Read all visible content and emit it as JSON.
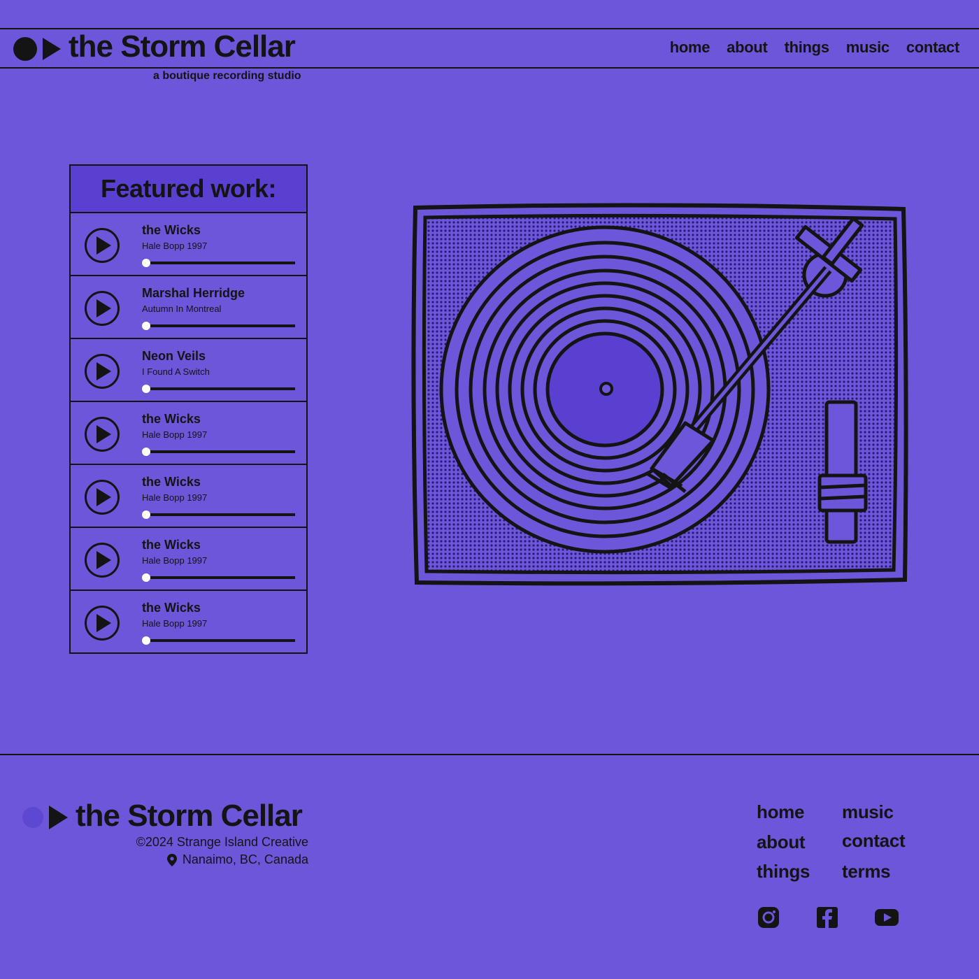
{
  "brand": {
    "name": "the Storm Cellar",
    "tagline": "a boutique recording studio"
  },
  "nav": [
    "home",
    "about",
    "things",
    "music",
    "contact"
  ],
  "featured": {
    "title": "Featured work:",
    "tracks": [
      {
        "artist": "the Wicks",
        "song": "Hale Bopp 1997",
        "progress": 0
      },
      {
        "artist": "Marshal Herridge",
        "song": "Autumn In Montreal",
        "progress": 0
      },
      {
        "artist": "Neon Veils",
        "song": "I Found A Switch",
        "progress": 0
      },
      {
        "artist": "the Wicks",
        "song": "Hale Bopp 1997",
        "progress": 0
      },
      {
        "artist": "the Wicks",
        "song": "Hale Bopp 1997",
        "progress": 0
      },
      {
        "artist": "the Wicks",
        "song": "Hale Bopp 1997",
        "progress": 0
      },
      {
        "artist": "the Wicks",
        "song": "Hale Bopp 1997",
        "progress": 0
      }
    ]
  },
  "footer": {
    "copyright": "©2024 Strange Island Creative",
    "location": "Nanaimo, BC, Canada",
    "links_col1": [
      "home",
      "about",
      "things"
    ],
    "links_col2": [
      "music",
      "contact",
      "terms"
    ],
    "social": [
      "instagram-icon",
      "facebook-icon",
      "youtube-icon"
    ]
  },
  "colors": {
    "background": "#6e56db",
    "panel": "#5b3fd1",
    "ink": "#141414"
  }
}
